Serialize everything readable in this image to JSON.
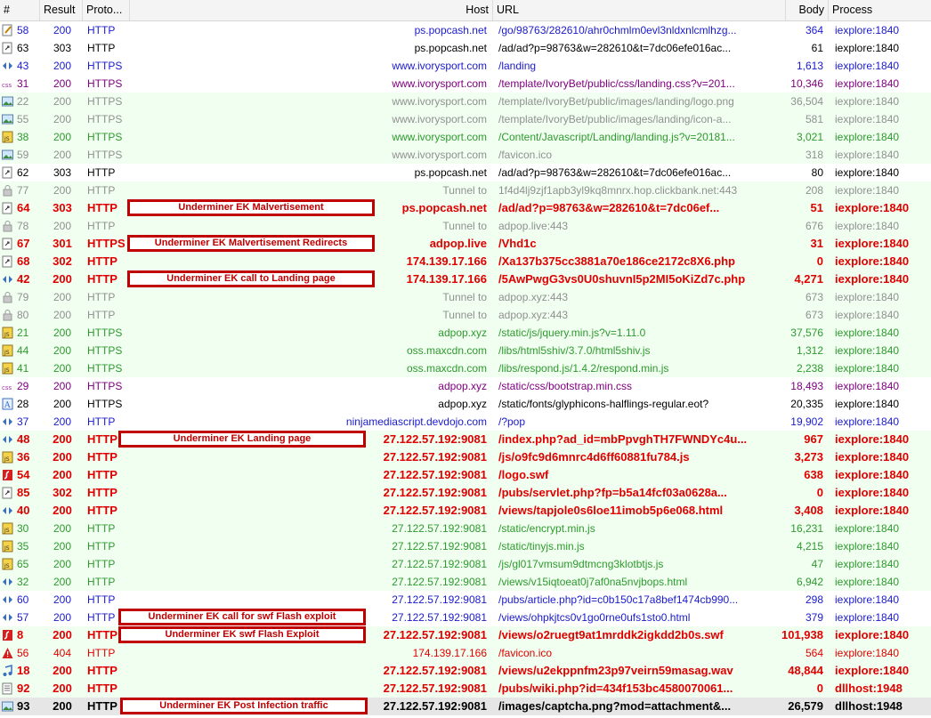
{
  "columns": {
    "num": "#",
    "result": "Result",
    "protocol": "Proto...",
    "host": "Host",
    "url": "URL",
    "body": "Body",
    "process": "Process"
  },
  "colors": {
    "green": "#2e9a2e",
    "blue": "#1a1acd",
    "purple": "#800080",
    "black": "#000000",
    "gray": "#909090",
    "red": "#e00000",
    "bg_green": "#f0fff0"
  },
  "rows": [
    {
      "icon": "edit-doc-icon",
      "num": "58",
      "result": "200",
      "protocol": "HTTP",
      "host": "ps.popcash.net",
      "url": "/go/98763/282610/ahr0chmlm0evl3nldxnlcmlhzg...",
      "body": "364",
      "process": "iexplore:1840",
      "color": "blue"
    },
    {
      "icon": "redirect-icon",
      "num": "63",
      "result": "303",
      "protocol": "HTTP",
      "host": "ps.popcash.net",
      "url": "/ad/ad?p=98763&w=282610&t=7dc06efe016ac...",
      "body": "61",
      "process": "iexplore:1840",
      "color": "black"
    },
    {
      "icon": "html-icon",
      "num": "43",
      "result": "200",
      "protocol": "HTTPS",
      "host": "www.ivorysport.com",
      "url": "/landing",
      "body": "1,613",
      "process": "iexplore:1840",
      "color": "blue"
    },
    {
      "icon": "css-icon",
      "num": "31",
      "result": "200",
      "protocol": "HTTPS",
      "host": "www.ivorysport.com",
      "url": "/template/IvoryBet/public/css/landing.css?v=201...",
      "body": "10,346",
      "process": "iexplore:1840",
      "color": "purple"
    },
    {
      "icon": "image-icon",
      "num": "22",
      "result": "200",
      "protocol": "HTTPS",
      "host": "www.ivorysport.com",
      "url": "/template/IvoryBet/public/images/landing/logo.png",
      "body": "36,504",
      "process": "iexplore:1840",
      "color": "gray"
    },
    {
      "icon": "image-icon",
      "num": "55",
      "result": "200",
      "protocol": "HTTPS",
      "host": "www.ivorysport.com",
      "url": "/template/IvoryBet/public/images/landing/icon-a...",
      "body": "581",
      "process": "iexplore:1840",
      "color": "gray"
    },
    {
      "icon": "js-icon",
      "num": "38",
      "result": "200",
      "protocol": "HTTPS",
      "host": "www.ivorysport.com",
      "url": "/Content/Javascript/Landing/landing.js?v=20181...",
      "body": "3,021",
      "process": "iexplore:1840",
      "color": "green"
    },
    {
      "icon": "image-icon",
      "num": "59",
      "result": "200",
      "protocol": "HTTPS",
      "host": "www.ivorysport.com",
      "url": "/favicon.ico",
      "body": "318",
      "process": "iexplore:1840",
      "color": "gray"
    },
    {
      "icon": "redirect-icon",
      "num": "62",
      "result": "303",
      "protocol": "HTTP",
      "host": "ps.popcash.net",
      "url": "/ad/ad?p=98763&w=282610&t=7dc06efe016ac...",
      "body": "80",
      "process": "iexplore:1840",
      "color": "black"
    },
    {
      "icon": "lock-icon",
      "num": "77",
      "result": "200",
      "protocol": "HTTP",
      "host": "Tunnel to",
      "url": "1f4d4lj9zjf1apb3yl9kq8mnrx.hop.clickbank.net:443",
      "body": "208",
      "process": "iexplore:1840",
      "color": "gray"
    },
    {
      "icon": "redirect-icon",
      "num": "64",
      "result": "303",
      "protocol": "HTTP",
      "host": "ps.popcash.net",
      "url": "/ad/ad?p=98763&w=282610&t=7dc06ef...",
      "body": "51",
      "process": "iexplore:1840",
      "color": "red",
      "bold": true
    },
    {
      "icon": "lock-icon",
      "num": "78",
      "result": "200",
      "protocol": "HTTP",
      "host": "Tunnel to",
      "url": "adpop.live:443",
      "body": "676",
      "process": "iexplore:1840",
      "color": "gray"
    },
    {
      "icon": "redirect-icon",
      "num": "67",
      "result": "301",
      "protocol": "HTTPS",
      "host": "adpop.live",
      "url": "/Vhd1c",
      "body": "31",
      "process": "iexplore:1840",
      "color": "red",
      "bold": true
    },
    {
      "icon": "redirect-icon",
      "num": "68",
      "result": "302",
      "protocol": "HTTP",
      "host": "174.139.17.166",
      "url": "/Xa137b375cc3881a70e186ce2172c8X6.php",
      "body": "0",
      "process": "iexplore:1840",
      "color": "red",
      "bold": true
    },
    {
      "icon": "html-icon",
      "num": "42",
      "result": "200",
      "protocol": "HTTP",
      "host": "174.139.17.166",
      "url": "/5AwPwgG3vs0U0shuvnI5p2MI5oKiZd7c.php",
      "body": "4,271",
      "process": "iexplore:1840",
      "color": "red",
      "bold": true
    },
    {
      "icon": "lock-icon",
      "num": "79",
      "result": "200",
      "protocol": "HTTP",
      "host": "Tunnel to",
      "url": "adpop.xyz:443",
      "body": "673",
      "process": "iexplore:1840",
      "color": "gray"
    },
    {
      "icon": "lock-icon",
      "num": "80",
      "result": "200",
      "protocol": "HTTP",
      "host": "Tunnel to",
      "url": "adpop.xyz:443",
      "body": "673",
      "process": "iexplore:1840",
      "color": "gray"
    },
    {
      "icon": "js-icon",
      "num": "21",
      "result": "200",
      "protocol": "HTTPS",
      "host": "adpop.xyz",
      "url": "/static/js/jquery.min.js?v=1.11.0",
      "body": "37,576",
      "process": "iexplore:1840",
      "color": "green"
    },
    {
      "icon": "js-icon",
      "num": "44",
      "result": "200",
      "protocol": "HTTPS",
      "host": "oss.maxcdn.com",
      "url": "/libs/html5shiv/3.7.0/html5shiv.js",
      "body": "1,312",
      "process": "iexplore:1840",
      "color": "green"
    },
    {
      "icon": "js-icon",
      "num": "41",
      "result": "200",
      "protocol": "HTTPS",
      "host": "oss.maxcdn.com",
      "url": "/libs/respond.js/1.4.2/respond.min.js",
      "body": "2,238",
      "process": "iexplore:1840",
      "color": "green"
    },
    {
      "icon": "css-icon",
      "num": "29",
      "result": "200",
      "protocol": "HTTPS",
      "host": "adpop.xyz",
      "url": "/static/css/bootstrap.min.css",
      "body": "18,493",
      "process": "iexplore:1840",
      "color": "purple"
    },
    {
      "icon": "font-icon",
      "num": "28",
      "result": "200",
      "protocol": "HTTPS",
      "host": "adpop.xyz",
      "url": "/static/fonts/glyphicons-halflings-regular.eot?",
      "body": "20,335",
      "process": "iexplore:1840",
      "color": "black"
    },
    {
      "icon": "html-icon",
      "num": "37",
      "result": "200",
      "protocol": "HTTP",
      "host": "ninjamediascript.devdojo.com",
      "url": "/?pop",
      "body": "19,902",
      "process": "iexplore:1840",
      "color": "blue"
    },
    {
      "icon": "html-icon",
      "num": "48",
      "result": "200",
      "protocol": "HTTP",
      "host": "27.122.57.192:9081",
      "url": "/index.php?ad_id=mbPpvghTH7FWNDYc4u...",
      "body": "967",
      "process": "iexplore:1840",
      "color": "red",
      "bold": true
    },
    {
      "icon": "js-icon",
      "num": "36",
      "result": "200",
      "protocol": "HTTP",
      "host": "27.122.57.192:9081",
      "url": "/js/o9fc9d6mnrc4d6ff60881fu784.js",
      "body": "3,273",
      "process": "iexplore:1840",
      "color": "red",
      "bold": true
    },
    {
      "icon": "flash-icon",
      "num": "54",
      "result": "200",
      "protocol": "HTTP",
      "host": "27.122.57.192:9081",
      "url": "/logo.swf",
      "body": "638",
      "process": "iexplore:1840",
      "color": "red",
      "bold": true
    },
    {
      "icon": "redirect-icon",
      "num": "85",
      "result": "302",
      "protocol": "HTTP",
      "host": "27.122.57.192:9081",
      "url": "/pubs/servlet.php?fp=b5a14fcf03a0628a...",
      "body": "0",
      "process": "iexplore:1840",
      "color": "red",
      "bold": true
    },
    {
      "icon": "html-icon",
      "num": "40",
      "result": "200",
      "protocol": "HTTP",
      "host": "27.122.57.192:9081",
      "url": "/views/tapjole0s6loe11imob5p6e068.html",
      "body": "3,408",
      "process": "iexplore:1840",
      "color": "red",
      "bold": true
    },
    {
      "icon": "js-icon",
      "num": "30",
      "result": "200",
      "protocol": "HTTP",
      "host": "27.122.57.192:9081",
      "url": "/static/encrypt.min.js",
      "body": "16,231",
      "process": "iexplore:1840",
      "color": "green"
    },
    {
      "icon": "js-icon",
      "num": "35",
      "result": "200",
      "protocol": "HTTP",
      "host": "27.122.57.192:9081",
      "url": "/static/tinyjs.min.js",
      "body": "4,215",
      "process": "iexplore:1840",
      "color": "green"
    },
    {
      "icon": "js-icon",
      "num": "65",
      "result": "200",
      "protocol": "HTTP",
      "host": "27.122.57.192:9081",
      "url": "/js/gl017vmsum9dtmcng3klotbtjs.js",
      "body": "47",
      "process": "iexplore:1840",
      "color": "green"
    },
    {
      "icon": "html-icon",
      "num": "32",
      "result": "200",
      "protocol": "HTTP",
      "host": "27.122.57.192:9081",
      "url": "/views/v15iqtoeat0j7af0na5nvjbops.html",
      "body": "6,942",
      "process": "iexplore:1840",
      "color": "green"
    },
    {
      "icon": "html-icon",
      "num": "60",
      "result": "200",
      "protocol": "HTTP",
      "host": "27.122.57.192:9081",
      "url": "/pubs/article.php?id=c0b150c17a8bef1474cb990...",
      "body": "298",
      "process": "iexplore:1840",
      "color": "blue"
    },
    {
      "icon": "html-icon",
      "num": "57",
      "result": "200",
      "protocol": "HTTP",
      "host": "27.122.57.192:9081",
      "url": "/views/ohpkjtcs0v1go0rne0ufs1sto0.html",
      "body": "379",
      "process": "iexplore:1840",
      "color": "blue"
    },
    {
      "icon": "flash-icon",
      "num": "8",
      "result": "200",
      "protocol": "HTTP",
      "host": "27.122.57.192:9081",
      "url": "/views/o2ruegt9at1mrddk2igkdd2b0s.swf",
      "body": "101,938",
      "process": "iexplore:1840",
      "color": "red",
      "bold": true
    },
    {
      "icon": "warning-icon",
      "num": "56",
      "result": "404",
      "protocol": "HTTP",
      "host": "174.139.17.166",
      "url": "/favicon.ico",
      "body": "564",
      "process": "iexplore:1840",
      "color": "red"
    },
    {
      "icon": "audio-icon",
      "num": "18",
      "result": "200",
      "protocol": "HTTP",
      "host": "27.122.57.192:9081",
      "url": "/views/u2ekppnfm23p97veirn59masag.wav",
      "body": "48,844",
      "process": "iexplore:1840",
      "color": "red",
      "bold": true
    },
    {
      "icon": "text-doc-icon",
      "num": "92",
      "result": "200",
      "protocol": "HTTP",
      "host": "27.122.57.192:9081",
      "url": "/pubs/wiki.php?id=434f153bc4580070061...",
      "body": "0",
      "process": "dllhost:1948",
      "color": "red",
      "bold": true
    },
    {
      "icon": "image-icon",
      "num": "93",
      "result": "200",
      "protocol": "HTTP",
      "host": "27.122.57.192:9081",
      "url": "/images/captcha.png?mod=attachment&...",
      "body": "26,579",
      "process": "dllhost:1948",
      "color": "black",
      "bold": true,
      "selected": true
    }
  ],
  "annotations": [
    {
      "row": 10,
      "text": "Underminer EK Malvertisement"
    },
    {
      "row": 12,
      "text": "Underminer EK Malvertisement Redirects"
    },
    {
      "row": 14,
      "text": "Underminer EK call to Landing page"
    },
    {
      "row": 23,
      "text": "Underminer EK Landing page"
    },
    {
      "row": 33,
      "text": "Underminer EK call for swf Flash exploit"
    },
    {
      "row": 34,
      "text": "Underminer EK swf Flash Exploit"
    },
    {
      "row": 38,
      "text": "Underminer EK Post Infection traffic"
    }
  ]
}
